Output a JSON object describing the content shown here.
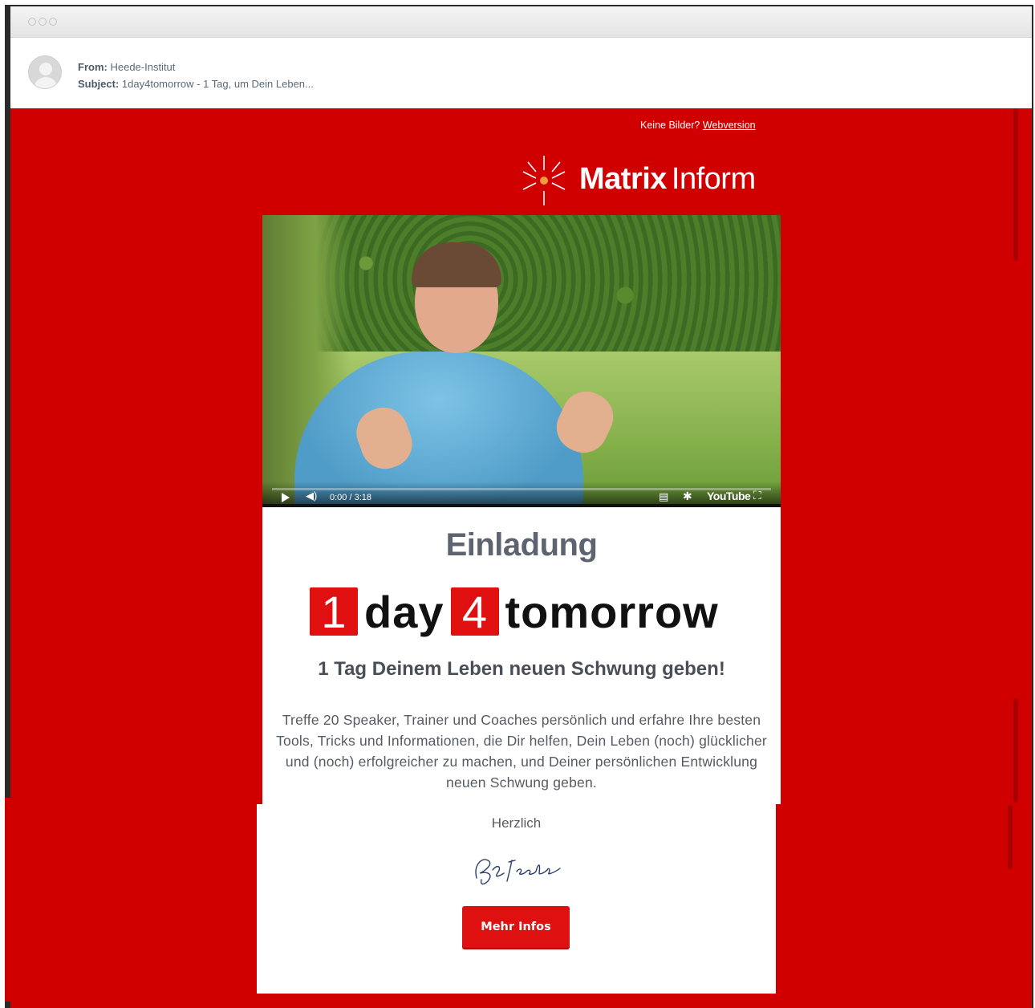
{
  "window": {
    "traffic_lights": [
      "close",
      "minimize",
      "maximize"
    ]
  },
  "email": {
    "from_label": "From:",
    "from_value": "Heede-Institut",
    "subject_label": "Subject:",
    "subject_value": "1day4tomorrow - 1 Tag, um Dein Leben..."
  },
  "newsletter": {
    "no_images_text": "Keine Bilder?",
    "webversion_link": "Webversion",
    "logo_bold": "Matrix",
    "logo_light": "Inform",
    "video": {
      "time": "0:00 / 3:18",
      "youtube_label": "YouTube",
      "icons": [
        "play-icon",
        "volume-icon",
        "captions-icon",
        "settings-icon",
        "fullscreen-icon"
      ]
    },
    "heading": "Einladung",
    "brand": {
      "num1": "1",
      "word1": "day",
      "num2": "4",
      "word2": "tomorrow"
    },
    "tagline": "1 Tag Deinem Leben neuen Schwung geben!",
    "body": "Treffe 20 Speaker, Trainer und Coaches persönlich und erfahre Ihre besten Tools, Tricks und Informationen, die Dir helfen, Dein Leben (noch) glücklicher und (noch) erfolgreicher zu machen, und Deiner persönlichen Entwicklung neuen Schwung geben.",
    "closing": "Herzlich",
    "cta": "Mehr Infos"
  },
  "colors": {
    "brand_red": "#d10000",
    "button_red": "#df1010",
    "heading_gray": "#5d6470"
  }
}
